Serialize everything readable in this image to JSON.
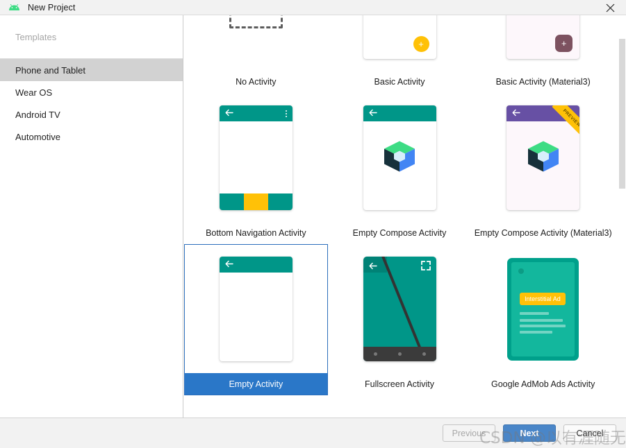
{
  "window": {
    "title": "New Project",
    "logo_icon": "android-logo-icon",
    "close_icon": "close-icon"
  },
  "sidebar": {
    "header_label": "Templates",
    "items": [
      {
        "label": "Phone and Tablet",
        "selected": true
      },
      {
        "label": "Wear OS",
        "selected": false
      },
      {
        "label": "Android TV",
        "selected": false
      },
      {
        "label": "Automotive",
        "selected": false
      }
    ]
  },
  "templates": {
    "rows": [
      [
        {
          "label": "No Activity",
          "selected": false,
          "thumb": "dashed-box"
        },
        {
          "label": "Basic Activity",
          "selected": false,
          "thumb": "fab-card"
        },
        {
          "label": "Basic Activity (Material3)",
          "selected": false,
          "thumb": "fab-card-m3"
        }
      ],
      [
        {
          "label": "Bottom Navigation Activity",
          "selected": false,
          "thumb": "bottom-nav-phone"
        },
        {
          "label": "Empty Compose Activity",
          "selected": false,
          "thumb": "compose-phone"
        },
        {
          "label": "Empty Compose Activity (Material3)",
          "selected": false,
          "thumb": "compose-phone-m3"
        }
      ],
      [
        {
          "label": "Empty Activity",
          "selected": true,
          "thumb": "empty-phone"
        },
        {
          "label": "Fullscreen Activity",
          "selected": false,
          "thumb": "fullscreen-phone"
        },
        {
          "label": "Google AdMob Ads Activity",
          "selected": false,
          "thumb": "admob-phone"
        }
      ]
    ],
    "ribbon_label": "PREVIEW",
    "ad_chip_label": "Interstitial Ad"
  },
  "footer": {
    "previous_label": "Previous",
    "next_label": "Next",
    "cancel_label": "Cancel"
  },
  "watermark": {
    "text": "CSDN @以有涯随无涯"
  },
  "colors": {
    "teal": "#009688",
    "yellow": "#ffc107",
    "purple": "#6750a4",
    "m3_maroon": "#7d5260",
    "selection_blue": "#2a77c8",
    "selection_border": "#2a6dbb",
    "admob_green": "#13b79d",
    "sidebar_selected": "#d2d2d2"
  }
}
